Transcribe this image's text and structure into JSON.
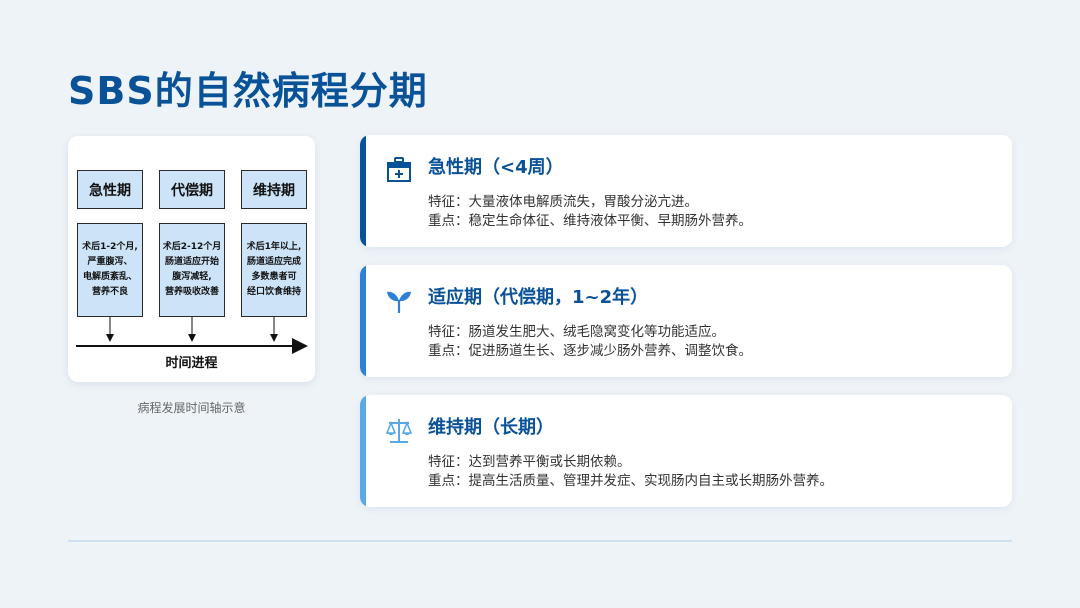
{
  "title": "SBS的自然病程分期",
  "diagram": {
    "stages": [
      {
        "name": "急性期",
        "desc": "术后1-2个月,\n严重腹泻、\n电解质紊乱、\n营养不良"
      },
      {
        "name": "代偿期",
        "desc": "术后2-12个月\n肠道适应开始\n腹泻减轻,\n营养吸收改善"
      },
      {
        "name": "维持期",
        "desc": "术后1年以上,\n肠道适应完成\n多数患者可\n经口饮食维持"
      }
    ],
    "axis_label": "时间进程",
    "caption": "病程发展时间轴示意"
  },
  "phases": [
    {
      "heading": "急性期（<4周）",
      "feature": "特征：大量液体电解质流失，胃酸分泌亢进。",
      "focus": "重点：稳定生命体征、维持液体平衡、早期肠外营养。",
      "icon": "medical-kit-icon",
      "accent": "#0a5297"
    },
    {
      "heading": "适应期（代偿期，1~2年）",
      "feature": "特征：肠道发生肥大、绒毛隐窝变化等功能适应。",
      "focus": "重点：促进肠道生长、逐步减少肠外营养、调整饮食。",
      "icon": "sprout-icon",
      "accent": "#2f7fd4"
    },
    {
      "heading": "维持期（长期）",
      "feature": "特征：达到营养平衡或长期依赖。",
      "focus": "重点：提高生活质量、管理并发症、实现肠内自主或长期肠外营养。",
      "icon": "balance-scale-icon",
      "accent": "#5ba8e6"
    }
  ]
}
